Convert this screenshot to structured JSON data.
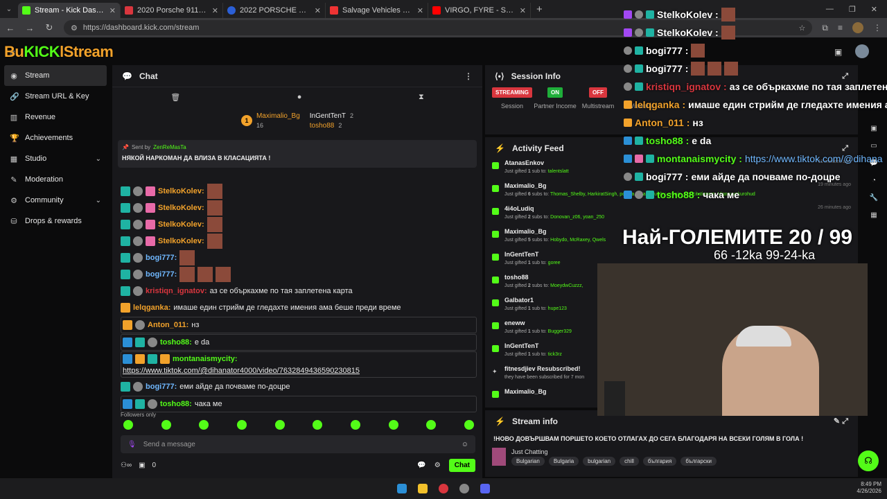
{
  "browser": {
    "tabs": [
      {
        "title": "Stream - Kick Dashboard",
        "color": "#53fc18",
        "active": true
      },
      {
        "title": "2020 Porsche 911 | $ 147,995 |",
        "color": "#d9363e"
      },
      {
        "title": "2022 PORSCHE 911 TURBO | Er",
        "color": "#2b5fd6"
      },
      {
        "title": "Salvage Vehicles For Sale | IAA",
        "color": "#e33"
      },
      {
        "title": "VIRGO, FYRE - SULZI ft. Yo",
        "color": "#f00"
      }
    ],
    "url": "https://dashboard.kick.com/stream",
    "new_tab": "+"
  },
  "logo": {
    "text_a": "Bu",
    "text_k": "KICK",
    "text_b": "lStream"
  },
  "sidebar": {
    "items": [
      {
        "label": "Stream",
        "icon": "stream-icon"
      },
      {
        "label": "Stream URL & Key",
        "icon": "link-icon"
      },
      {
        "label": "Revenue",
        "icon": "revenue-icon"
      },
      {
        "label": "Achievements",
        "icon": "trophy-icon"
      },
      {
        "label": "Studio",
        "icon": "studio-icon"
      },
      {
        "label": "Moderation",
        "icon": "moderation-icon"
      },
      {
        "label": "Community",
        "icon": "community-icon"
      },
      {
        "label": "Drops & rewards",
        "icon": "drops-icon"
      }
    ]
  },
  "chat": {
    "title": "Chat",
    "leaderboard": {
      "first_name": "Maximalio_Bg",
      "first_count": "16",
      "second_name": "InGentTenT",
      "second_count": "2",
      "third_name": "tosho88",
      "third_count": "2"
    },
    "pinned": {
      "sent_by": "Sent by",
      "user": "ZenReMasTa",
      "message": "НЯКОЙ НАРКОМАН ДА ВЛИЗА В КЛАСАЦИЯТА !"
    },
    "messages": [
      {
        "user": "StelkoKolev:",
        "text": ""
      },
      {
        "user": "StelkoKolev:",
        "text": ""
      },
      {
        "user": "StelkoKolev:",
        "text": ""
      },
      {
        "user": "StelkoKolev:",
        "text": ""
      },
      {
        "user": "bogi777:",
        "text": ""
      },
      {
        "user": "bogi777:",
        "text": ""
      },
      {
        "user": "kristiqn_ignatov:",
        "text": "аз се объркахме по тая заплетена карта"
      },
      {
        "user": "lelqganka:",
        "text": "имаше един стрийм де гледахте имения ама беше преди време"
      },
      {
        "user": "Anton_011:",
        "text": "нз"
      },
      {
        "user": "tosho88:",
        "text": "е da"
      },
      {
        "user": "montanaismycity:",
        "text": "https://www.tiktok.com/@dihanator4000/video/7632849436590230815"
      },
      {
        "user": "bogi777:",
        "text": "еми айде да почваме по-доцре"
      },
      {
        "user": "tosho88:",
        "text": "чака ме"
      }
    ],
    "followers_only": "Followers only",
    "input_placeholder": "Send a message",
    "footer_count": "0",
    "chat_button": "Chat"
  },
  "session": {
    "title": "Session Info",
    "streaming_badge": "STREAMING",
    "streaming_label": "Session",
    "partner_badge": "ON",
    "partner_label": "Partner Income",
    "multi_badge": "OFF",
    "multi_label": "Multistream",
    "viewers_label": "Viewers",
    "colors": {
      "streaming": "#d9363e",
      "on": "#1fae3a",
      "off": "#d9363e"
    }
  },
  "activity": {
    "title": "Activity Feed",
    "items": [
      {
        "name": "AtanasEnkov",
        "desc_a": "Just gifted ",
        "n": "1",
        "desc_b": " sub to: ",
        "to": "talentslatt",
        "time": "11 minutes ago"
      },
      {
        "name": "Maximalio_Bg",
        "desc_a": "Just gifted ",
        "n": "6",
        "desc_b": " subs to: ",
        "to": "Thomas_Shelby, HarkiratSingh, pontita, BeanSquishy, omnis_exercitationem, Vigocuvekurohud",
        "time": "19 minutes ago"
      },
      {
        "name": "4i4oLudiq",
        "desc_a": "Just gifted ",
        "n": "2",
        "desc_b": " subs to: ",
        "to": "Donovan_z06, yoan_250",
        "time": "26 minutes ago"
      },
      {
        "name": "Maximalio_Bg",
        "desc_a": "Just gifted ",
        "n": "5",
        "desc_b": " subs to: ",
        "to": "Hobydo, McRaxey, Qwels",
        "time": ""
      },
      {
        "name": "InGentTenT",
        "desc_a": "Just gifted ",
        "n": "1",
        "desc_b": " sub to: ",
        "to": "goree",
        "time": ""
      },
      {
        "name": "tosho88",
        "desc_a": "Just gifted ",
        "n": "2",
        "desc_b": " subs to: ",
        "to": "MoeydwCuzzz,",
        "time": ""
      },
      {
        "name": "Galbator1",
        "desc_a": "Just gifted ",
        "n": "1",
        "desc_b": " sub to: ",
        "to": "hupe123",
        "time": ""
      },
      {
        "name": "eneww",
        "desc_a": "Just gifted ",
        "n": "1",
        "desc_b": " sub to: ",
        "to": "Bugger329",
        "time": ""
      },
      {
        "name": "InGentTenT",
        "desc_a": "Just gifted ",
        "n": "1",
        "desc_b": " sub to: ",
        "to": "tick3rz",
        "time": ""
      },
      {
        "name": "fitnesdjiev Resubscribed!",
        "desc_a": "they have been subscribed for 7 mon",
        "n": "",
        "desc_b": "",
        "to": "",
        "time": ""
      },
      {
        "name": "Maximalio_Bg",
        "desc_a": "",
        "n": "",
        "desc_b": "",
        "to": "",
        "time": ""
      }
    ]
  },
  "stream_info": {
    "title": "Stream info",
    "stream_title": "!НОВО ДОВЪРШВАМ ПОРШЕТО КОЕТО ОТЛАГАХ ДО СЕГА БЛАГОДАРЯ НА ВСЕКИ ГОЛЯМ В ГОЛА !",
    "category": "Just Chatting",
    "tags": [
      "Bulgarian",
      "Bulgaria",
      "bulgarian",
      "chill",
      "българия",
      "български"
    ]
  },
  "overlay": {
    "chat": [
      {
        "user": "StelkoKolev :",
        "text": "",
        "color": "#ffffff"
      },
      {
        "user": "StelkoKolev :",
        "text": "",
        "color": "#ffffff"
      },
      {
        "user": "bogi777 :",
        "text": "",
        "color": "#ffffff"
      },
      {
        "user": "bogi777 :",
        "text": "",
        "color": "#ffffff"
      },
      {
        "user": "kristiqn_ignatov :",
        "text": "аз се объркахме по тая заплетена ка",
        "color": "#d9363e"
      },
      {
        "user": "lelqganka :",
        "text": "имаше един стрийм де гледахте имения а",
        "color": "#f2a22b"
      },
      {
        "user": "Anton_011 :",
        "text": "нз",
        "color": "#f2a22b"
      },
      {
        "user": "tosho88 :",
        "text": "е da",
        "color": "#53fc18"
      },
      {
        "user": "montanaismycity :",
        "text": "https://www.tiktok.com/@dihana",
        "color": "#53fc18"
      },
      {
        "user": "bogi777 :",
        "text": "еми айде да почваме по-доцре",
        "color": "#ffffff"
      },
      {
        "user": "tosho88 :",
        "text": "чака ме",
        "color": "#53fc18"
      }
    ],
    "headline": "Най-ГОЛЕМИТЕ 20 / 99",
    "subline": "66 -12ka 99-24-ka"
  },
  "taskbar": {
    "time": "8:49 PM",
    "date": "4/26/2026"
  }
}
